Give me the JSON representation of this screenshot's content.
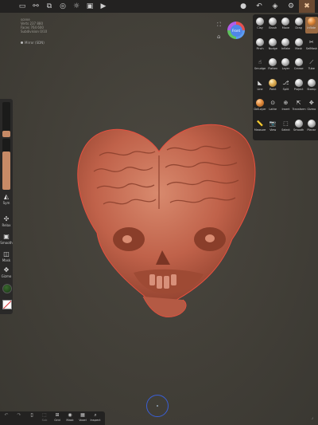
{
  "top_bar": {
    "left_icons": [
      "folder-icon",
      "share-icon",
      "layers-icon",
      "globe-icon",
      "sun-icon",
      "image-icon",
      "video-icon"
    ],
    "right_icons": [
      "matcap-icon",
      "undo-icon",
      "stack-icon",
      "gear-icon",
      "tools-icon"
    ]
  },
  "scene_info": {
    "line1": "scene",
    "line2": "Verts  237 880",
    "line3": "Faces  764 600",
    "line4": "Subdivision  0/10"
  },
  "mirror_label": "Mirror (SDN)",
  "gizmo": {
    "label": "Front"
  },
  "left_panel": {
    "radius_fill": 0.18,
    "intensity_fill": 0.75,
    "tools": [
      {
        "label": "Sym",
        "icon": "symmetry-icon",
        "glyph": "◭"
      },
      {
        "label": "Relax",
        "icon": "relax-icon",
        "glyph": "✣"
      },
      {
        "label": "Smooth",
        "icon": "smooth-icon",
        "glyph": "▣"
      },
      {
        "label": "Mask",
        "icon": "mask-icon",
        "glyph": "◫"
      },
      {
        "label": "Gizmo",
        "icon": "gizmo-icon",
        "glyph": "✥"
      }
    ]
  },
  "tools": [
    {
      "label": "Clay",
      "style": "sphere"
    },
    {
      "label": "Brush",
      "style": "sphere"
    },
    {
      "label": "Move",
      "style": "sphere"
    },
    {
      "label": "Drag",
      "style": "sphere"
    },
    {
      "label": "Inflate",
      "style": "orange",
      "active": true
    },
    {
      "label": "Pinch",
      "style": "sphere"
    },
    {
      "label": "Nudge",
      "style": "sphere"
    },
    {
      "label": "Inflate",
      "style": "sphere"
    },
    {
      "label": "Mask",
      "style": "sphere"
    },
    {
      "label": "SelMask",
      "style": "glyph",
      "glyph": "✂"
    },
    {
      "label": "Smudge",
      "style": "glyph",
      "glyph": "☝"
    },
    {
      "label": "Flatten",
      "style": "sphere"
    },
    {
      "label": "Layer",
      "style": "sphere"
    },
    {
      "label": "Crease",
      "style": "sphere"
    },
    {
      "label": "Tube",
      "style": "glyph",
      "glyph": "⟋"
    },
    {
      "label": "Line",
      "style": "glyph",
      "glyph": "◣"
    },
    {
      "label": "Paint",
      "style": "gold"
    },
    {
      "label": "Split",
      "style": "glyph",
      "glyph": "⎇"
    },
    {
      "label": "Project",
      "style": "sphere"
    },
    {
      "label": "Stamp",
      "style": "sphere"
    },
    {
      "label": "DelLayer",
      "style": "orange"
    },
    {
      "label": "Lathe",
      "style": "glyph",
      "glyph": "⊙"
    },
    {
      "label": "Insert",
      "style": "glyph",
      "glyph": "⊕"
    },
    {
      "label": "Transform",
      "style": "glyph",
      "glyph": "⇱"
    },
    {
      "label": "Gizmo",
      "style": "glyph",
      "glyph": "✥"
    },
    {
      "label": "Measure",
      "style": "glyph",
      "glyph": "📏"
    },
    {
      "label": "View",
      "style": "glyph",
      "glyph": "📷"
    },
    {
      "label": "Select",
      "style": "glyph",
      "glyph": "⬚"
    },
    {
      "label": "Smooth",
      "style": "sphere"
    },
    {
      "label": "Planar",
      "style": "sphere"
    }
  ],
  "bottom_bar": [
    {
      "label": "",
      "glyph": "↶",
      "icon": "undo-icon",
      "dim": true
    },
    {
      "label": "",
      "glyph": "↷",
      "icon": "redo-icon",
      "dim": true
    },
    {
      "label": "",
      "glyph": "▯",
      "icon": "phone-icon",
      "dim": false
    },
    {
      "label": "Sub",
      "glyph": "⬚",
      "icon": "subdivide-icon",
      "dim": true
    },
    {
      "label": "Grid",
      "glyph": "⊞",
      "icon": "grid-icon",
      "dim": false
    },
    {
      "label": "Mask",
      "glyph": "◉",
      "icon": "mask-icon",
      "dim": false
    },
    {
      "label": "Voxel",
      "glyph": "▦",
      "icon": "voxel-icon",
      "dim": false
    },
    {
      "label": "Inspect",
      "glyph": "⌕",
      "icon": "inspect-icon",
      "dim": false
    }
  ],
  "colors": {
    "accent": "#c78a66",
    "clay": "#c0624a",
    "selection_outline": "#e85040",
    "joystick": "#3a5fd6"
  }
}
